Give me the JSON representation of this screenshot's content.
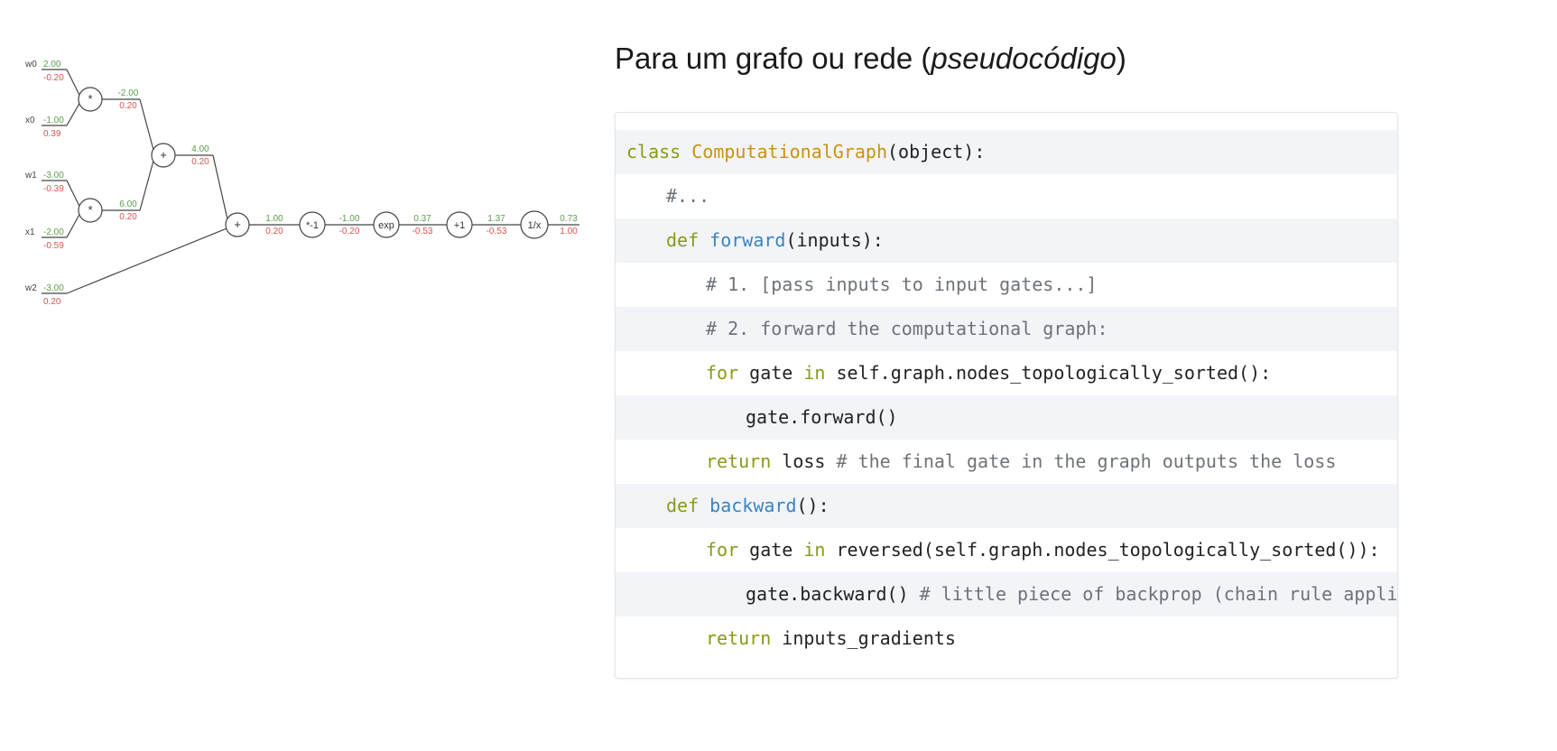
{
  "heading": {
    "prefix": "Para um grafo ou rede (",
    "italic": "pseudocódigo",
    "suffix": ")"
  },
  "diagram": {
    "colors": {
      "value": "#5a9e4a",
      "gradient": "#d9534f",
      "line": "#444444"
    },
    "inputs": [
      {
        "name": "w0",
        "value": "2.00",
        "grad": "-0.20"
      },
      {
        "name": "x0",
        "value": "-1.00",
        "grad": "0.39"
      },
      {
        "name": "w1",
        "value": "-3.00",
        "grad": "-0.39"
      },
      {
        "name": "x1",
        "value": "-2.00",
        "grad": "-0.59"
      },
      {
        "name": "w2",
        "value": "-3.00",
        "grad": "0.20"
      }
    ],
    "gates": [
      {
        "id": "mul0",
        "label": "*"
      },
      {
        "id": "mul1",
        "label": "*"
      },
      {
        "id": "add0",
        "label": "+"
      },
      {
        "id": "add1",
        "label": "+"
      },
      {
        "id": "neg",
        "label": "*-1"
      },
      {
        "id": "exp",
        "label": "exp"
      },
      {
        "id": "plus1",
        "label": "+1"
      },
      {
        "id": "recip",
        "label": "1/x"
      }
    ],
    "edges": [
      {
        "value": "-2.00",
        "grad": "0.20"
      },
      {
        "value": "6.00",
        "grad": "0.20"
      },
      {
        "value": "4.00",
        "grad": "0.20"
      },
      {
        "value": "1.00",
        "grad": "0.20"
      },
      {
        "value": "-1.00",
        "grad": "-0.20"
      },
      {
        "value": "0.37",
        "grad": "-0.53"
      },
      {
        "value": "1.37",
        "grad": "-0.53"
      },
      {
        "value": "0.73",
        "grad": "1.00"
      }
    ]
  },
  "code": {
    "lines": [
      {
        "indent": 0,
        "tokens": [
          {
            "t": "class ",
            "c": "kw"
          },
          {
            "t": "ComputationalGraph",
            "c": "class"
          },
          {
            "t": "(object):",
            "c": "plain"
          }
        ]
      },
      {
        "indent": 1,
        "tokens": [
          {
            "t": "#...",
            "c": "com"
          }
        ]
      },
      {
        "indent": 1,
        "tokens": [
          {
            "t": "def ",
            "c": "kw"
          },
          {
            "t": "forward",
            "c": "func"
          },
          {
            "t": "(inputs):",
            "c": "plain"
          }
        ]
      },
      {
        "indent": 2,
        "tokens": [
          {
            "t": "# 1. [pass inputs to input gates...]",
            "c": "com"
          }
        ]
      },
      {
        "indent": 2,
        "tokens": [
          {
            "t": "# 2. forward the computational graph:",
            "c": "com"
          }
        ]
      },
      {
        "indent": 2,
        "tokens": [
          {
            "t": "for",
            "c": "kw"
          },
          {
            "t": " gate ",
            "c": "plain"
          },
          {
            "t": "in",
            "c": "kw"
          },
          {
            "t": " self.graph.nodes_topologically_sorted():",
            "c": "plain"
          }
        ]
      },
      {
        "indent": 3,
        "tokens": [
          {
            "t": "gate.forward()",
            "c": "plain"
          }
        ]
      },
      {
        "indent": 2,
        "tokens": [
          {
            "t": "return",
            "c": "kw"
          },
          {
            "t": " loss ",
            "c": "plain"
          },
          {
            "t": "# the final gate in the graph outputs the loss",
            "c": "com"
          }
        ]
      },
      {
        "indent": 1,
        "tokens": [
          {
            "t": "def ",
            "c": "kw"
          },
          {
            "t": "backward",
            "c": "func"
          },
          {
            "t": "():",
            "c": "plain"
          }
        ]
      },
      {
        "indent": 2,
        "tokens": [
          {
            "t": "for",
            "c": "kw"
          },
          {
            "t": " gate ",
            "c": "plain"
          },
          {
            "t": "in",
            "c": "kw"
          },
          {
            "t": " reversed(self.graph.nodes_topologically_sorted()):",
            "c": "plain"
          }
        ]
      },
      {
        "indent": 3,
        "tokens": [
          {
            "t": "gate.backward() ",
            "c": "plain"
          },
          {
            "t": "# little piece of backprop (chain rule applied)",
            "c": "com"
          }
        ]
      },
      {
        "indent": 2,
        "tokens": [
          {
            "t": "return",
            "c": "kw"
          },
          {
            "t": " inputs_gradients",
            "c": "plain"
          }
        ]
      }
    ]
  }
}
